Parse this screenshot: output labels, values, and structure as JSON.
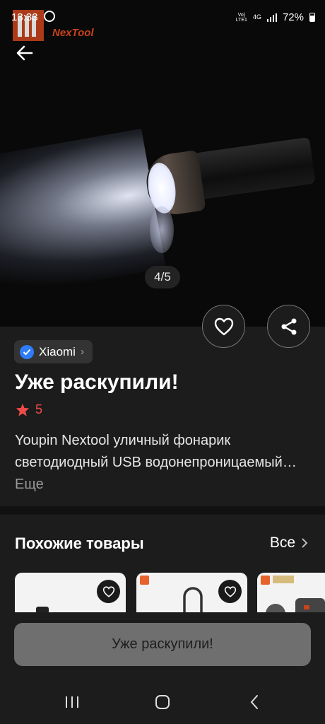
{
  "status_bar": {
    "time": "13:33",
    "network_top": "Vo)",
    "network_bottom": "LTE1",
    "network_type": "4G",
    "battery": "72%"
  },
  "brand_logo": {
    "text": "NexTool"
  },
  "gallery": {
    "pager": "4/5"
  },
  "brand": {
    "name": "Xiaomi",
    "verified_color": "#2e7cf6"
  },
  "product": {
    "title": "Уже раскупили!",
    "rating": "5",
    "description": "Youpin Nextool уличный фонарик светодиодный USB водонепроницаемый…",
    "more": "Еще"
  },
  "similar": {
    "title": "Похожие товары",
    "see_all": "Все"
  },
  "buy_button": {
    "label": "Уже раскупили!"
  },
  "colors": {
    "background": "#1c1c1c",
    "rating_red": "#f14a4a",
    "button_gray": "#6f6f6f"
  },
  "icons": [
    "back-arrow-icon",
    "heart-icon",
    "share-icon",
    "verified-icon",
    "chevron-right-icon",
    "star-icon",
    "recent-apps-icon",
    "home-icon",
    "nav-back-icon"
  ]
}
